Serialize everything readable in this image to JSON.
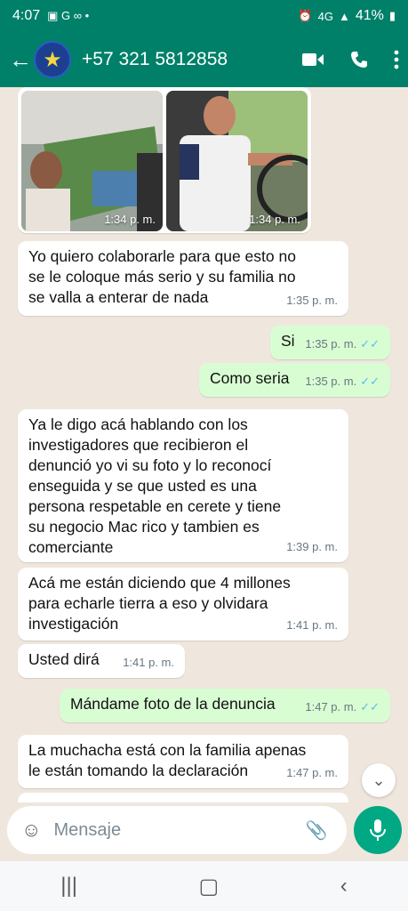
{
  "status": {
    "time": "4:07",
    "battery": "41%",
    "network": "4G"
  },
  "header": {
    "contact": "+57 321 5812858"
  },
  "messages": {
    "img_time_1": "1:34 p. m.",
    "img_time_2": "1:34 p. m.",
    "m1_line1": "Yo quiero colaborarle para que esto no",
    "m1_line2": "se le coloque más serio y su familia no",
    "m1_line3": "se valla a enterar de nada",
    "m1_time": "1:35 p. m.",
    "m2": "Si",
    "m2_time": "1:35 p. m.",
    "m3": "Como seria",
    "m3_time": "1:35 p. m.",
    "m4_line1": "Ya le digo acá hablando con los",
    "m4_line2": "investigadores que recibieron el",
    "m4_line3": "denunció yo vi su foto y lo reconocí",
    "m4_line4": "enseguida y se que usted es una",
    "m4_line5": "persona respetable en cerete y tiene",
    "m4_line6": "su negocio Mac rico y tambien es",
    "m4_line7": "comerciante",
    "m4_time": "1:39 p. m.",
    "m5_line1": "Acá me están diciendo que 4 millones",
    "m5_line2": "para echarle tierra a eso y olvidara",
    "m5_line3": "investigación",
    "m5_time": "1:41 p. m.",
    "m6": "Usted dirá",
    "m6_time": "1:41 p. m.",
    "m7": "Mándame foto de la denuncia",
    "m7_time": "1:47 p. m.",
    "m8_line1": "La muchacha está con la familia apenas",
    "m8_line2": "le están tomando la declaración",
    "m8_time": "1:47 p. m."
  },
  "input": {
    "placeholder": "Mensaje"
  },
  "icons": {
    "back": "arrow-left-icon",
    "video": "video-call-icon",
    "call": "phone-icon",
    "menu": "more-vert-icon",
    "emoji": "emoji-icon",
    "attach": "paperclip-icon",
    "camera": "camera-icon",
    "mic": "mic-icon",
    "scroll": "chevron-down-icon"
  },
  "colors": {
    "header": "#008069",
    "outgoing": "#d9fdd3",
    "incoming": "#ffffff",
    "background": "#efe7dd",
    "accent": "#00a884",
    "read_ticks": "#53bdeb"
  }
}
